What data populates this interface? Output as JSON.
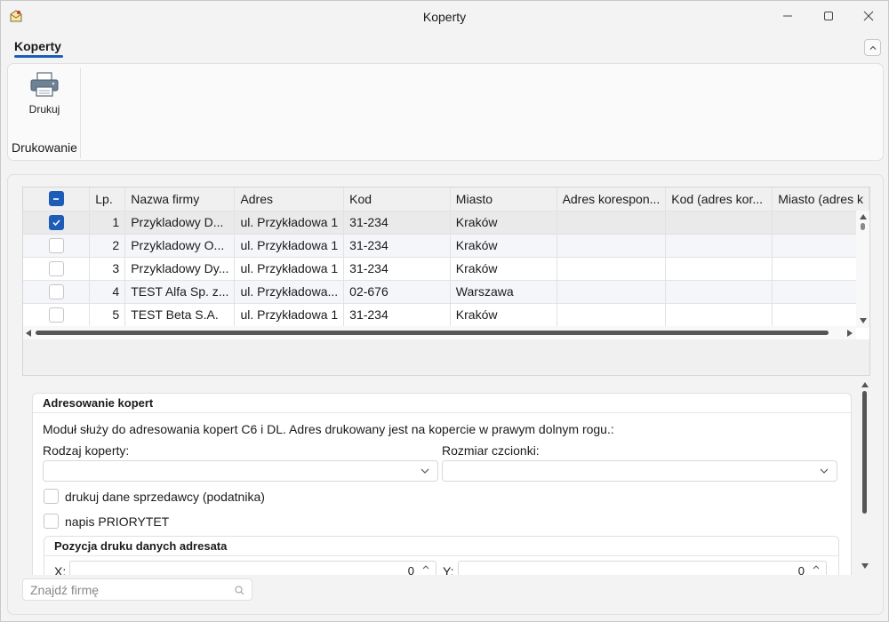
{
  "window": {
    "title": "Koperty",
    "minimize_icon": "minimize-icon",
    "maximize_icon": "maximize-icon",
    "close_icon": "close-icon"
  },
  "ribbon": {
    "tab_label": "Koperty",
    "print_button_label": "Drukuj",
    "group_label": "Drukowanie"
  },
  "grid": {
    "columns": [
      "Lp.",
      "Nazwa firmy",
      "Adres",
      "Kod",
      "Miasto",
      "Adres korespon...",
      "Kod (adres kor...",
      "Miasto (adres k"
    ],
    "rows": [
      {
        "checked": true,
        "lp": "1",
        "nazwa": "Przykladowy D...",
        "adres": "ul. Przykładowa 1",
        "kod": "31-234",
        "miasto": "Kraków"
      },
      {
        "checked": false,
        "lp": "2",
        "nazwa": "Przykladowy O...",
        "adres": "ul. Przykładowa 1",
        "kod": "31-234",
        "miasto": "Kraków"
      },
      {
        "checked": false,
        "lp": "3",
        "nazwa": "Przykladowy Dy...",
        "adres": "ul. Przykładowa 1",
        "kod": "31-234",
        "miasto": "Kraków"
      },
      {
        "checked": false,
        "lp": "4",
        "nazwa": "TEST Alfa Sp. z...",
        "adres": "ul. Przykładowa...",
        "kod": "02-676",
        "miasto": "Warszawa"
      },
      {
        "checked": false,
        "lp": "5",
        "nazwa": "TEST Beta S.A.",
        "adres": "ul. Przykładowa 1",
        "kod": "31-234",
        "miasto": "Kraków"
      }
    ]
  },
  "panel": {
    "title": "Adresowanie kopert",
    "description": "Moduł służy do adresowania kopert C6 i DL. Adres drukowany jest na kopercie w prawym dolnym rogu.:",
    "envelope_type_label": "Rodzaj koperty:",
    "envelope_type_value": "",
    "font_size_label": "Rozmiar czcionki:",
    "font_size_value": "",
    "seller_checkbox_label": "drukuj dane sprzedawcy (podatnika)",
    "priority_checkbox_label": "napis PRIORYTET",
    "position_title": "Pozycja druku danych adresata",
    "x_label": "X:",
    "x_value": "0",
    "y_label": "Y:",
    "y_value": "0"
  },
  "search": {
    "placeholder": "Znajdź firmę"
  },
  "colors": {
    "accent": "#1d5db8"
  }
}
